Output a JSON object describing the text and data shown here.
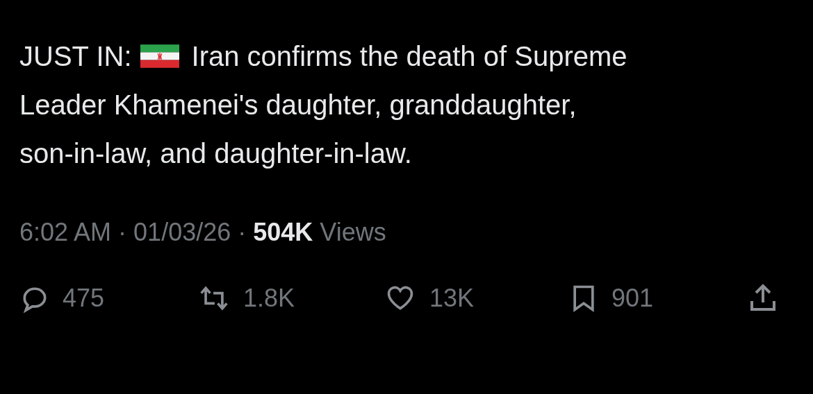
{
  "post": {
    "label": "JUST IN:",
    "lines": [
      "Iran confirms the death of Supreme",
      "Leader Khamenei's daughter, granddaughter,",
      "son-in-law, and daughter-in-law."
    ]
  },
  "meta": {
    "time": "6:02 AM",
    "separator_1": "·",
    "date": "01/03/26",
    "separator_2": "·",
    "views_count": "504K",
    "views_label": "Views"
  },
  "actions": [
    {
      "kind": "reply",
      "count": "475"
    },
    {
      "kind": "repost",
      "count": "1.8K"
    },
    {
      "kind": "like",
      "count": "13K"
    },
    {
      "kind": "bookmark",
      "count": "901"
    },
    {
      "kind": "share"
    }
  ]
}
